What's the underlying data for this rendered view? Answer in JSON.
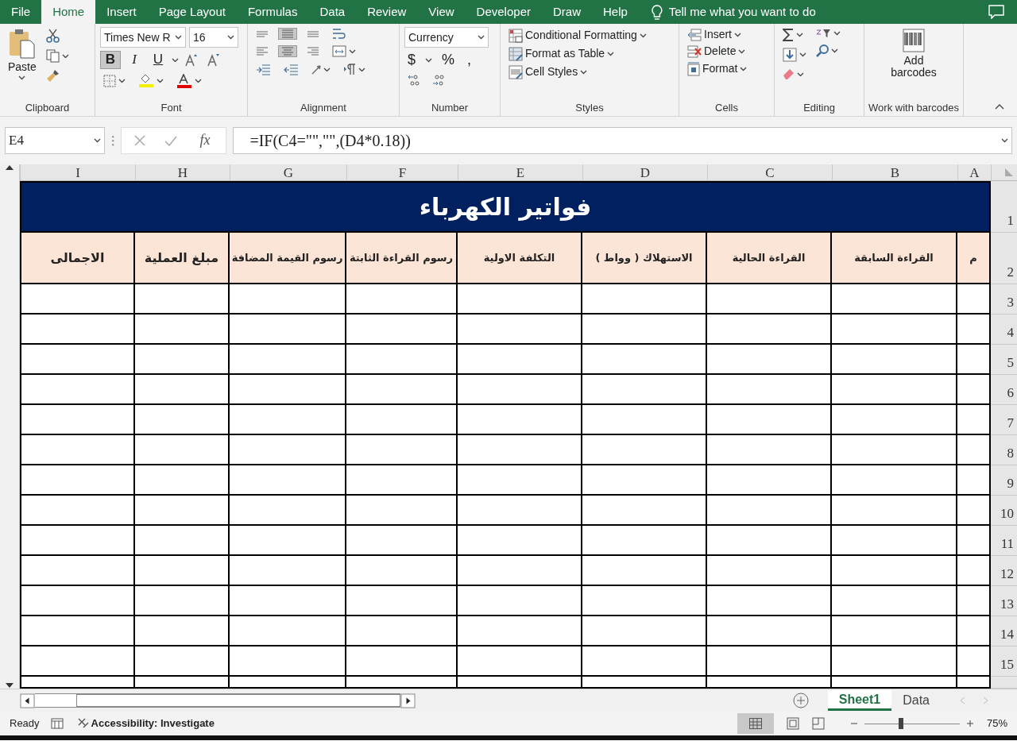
{
  "menu": {
    "tabs": [
      {
        "label": "File",
        "selected": false
      },
      {
        "label": "Home",
        "selected": true
      },
      {
        "label": "Insert",
        "selected": false
      },
      {
        "label": "Page Layout",
        "selected": false
      },
      {
        "label": "Formulas",
        "selected": false
      },
      {
        "label": "Data",
        "selected": false
      },
      {
        "label": "Review",
        "selected": false
      },
      {
        "label": "View",
        "selected": false
      },
      {
        "label": "Developer",
        "selected": false
      },
      {
        "label": "Draw",
        "selected": false
      },
      {
        "label": "Help",
        "selected": false
      }
    ],
    "tell_me": "Tell me what you want to do"
  },
  "ribbon": {
    "clipboard": {
      "paste": "Paste",
      "label": "Clipboard"
    },
    "font": {
      "name": "Times New R",
      "size": "16",
      "styles": [
        {
          "label": "B",
          "selected": true
        },
        {
          "label": "I",
          "selected": false
        },
        {
          "label": "U",
          "selected": false
        }
      ],
      "label": "Font"
    },
    "alignment": {
      "buttons": [
        {
          "kind": "align-top",
          "selected": false
        },
        {
          "kind": "align-middle",
          "selected": true
        },
        {
          "kind": "align-bottom",
          "selected": false
        },
        {
          "kind": "wrap",
          "selected": false
        },
        {
          "kind": "align-left",
          "selected": false
        },
        {
          "kind": "align-center",
          "selected": true
        },
        {
          "kind": "align-right",
          "selected": false
        },
        {
          "kind": "merge",
          "selected": false
        }
      ],
      "label": "Alignment"
    },
    "number": {
      "format": "Currency",
      "symbols": [
        "$",
        "%",
        ","
      ],
      "label": "Number"
    },
    "styles": {
      "items": [
        "Conditional Formatting",
        "Format as Table",
        "Cell Styles"
      ],
      "label": "Styles"
    },
    "cells": {
      "items": [
        "Insert",
        "Delete",
        "Format"
      ],
      "label": "Cells"
    },
    "editing": {
      "label": "Editing"
    },
    "barcodes": {
      "button": "Add barcodes",
      "label": "Work with barcodes"
    }
  },
  "formula_bar": {
    "name_box": "E4",
    "fx": "fx",
    "formula": "=IF(C4=\"\",\"\",(D4*0.18))"
  },
  "sheet": {
    "columns": [
      "I",
      "H",
      "G",
      "F",
      "E",
      "D",
      "C",
      "B",
      "A"
    ],
    "title": "فواتير الكهرباء",
    "headers": [
      {
        "text": "م",
        "kind": "normal"
      },
      {
        "text": "القراءة السابقة",
        "kind": "normal"
      },
      {
        "text": "القراءة الحالية",
        "kind": "normal"
      },
      {
        "text": "الاستهلاك ( وواط )",
        "kind": "normal"
      },
      {
        "text": "التكلفة الاولية",
        "kind": "normal"
      },
      {
        "text": "رسوم القراءة الثابتة",
        "kind": "normal"
      },
      {
        "text": "رسوم القيمة المضافة",
        "kind": "normal"
      },
      {
        "text": "مبلغ العملية",
        "kind": "large"
      },
      {
        "text": "الاجمالى",
        "kind": "large"
      }
    ],
    "rows": [
      "1",
      "2",
      "3",
      "4",
      "5",
      "6",
      "7",
      "8",
      "9",
      "10",
      "11",
      "12",
      "13",
      "14",
      "15"
    ]
  },
  "sheet_tabs": [
    {
      "label": "Sheet1",
      "selected": true
    },
    {
      "label": "Data",
      "selected": false
    }
  ],
  "status_bar": {
    "ready": "Ready",
    "accessibility": "Accessibility: Investigate",
    "zoom": "75%",
    "zoom_slider": {
      "level": 0.38
    }
  }
}
